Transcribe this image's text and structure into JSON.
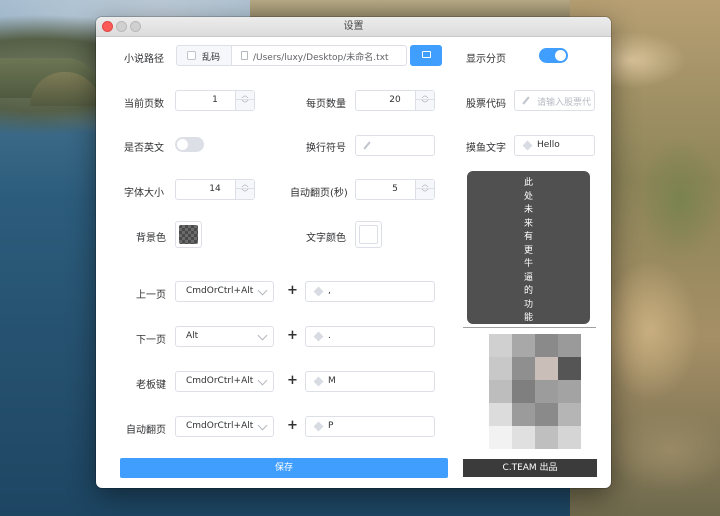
{
  "window": {
    "title": "设置"
  },
  "labels": {
    "novel_path": "小说路径",
    "show_paging": "显示分页",
    "current_page": "当前页数",
    "per_page": "每页数量",
    "stock_code": "股票代码",
    "is_english": "是否英文",
    "line_break": "换行符号",
    "fish_text": "摸鱼文字",
    "font_size": "字体大小",
    "auto_page_sec": "自动翻页(秒)",
    "bg_color": "背景色",
    "text_color": "文字颜色",
    "prev_page": "上一页",
    "next_page": "下一页",
    "boss_key": "老板键",
    "auto_page": "自动翻页"
  },
  "path_field": {
    "garbled_label": "乱码",
    "garbled_checked": false,
    "path_value": "/Users/luxy/Desktop/未命名.txt",
    "folder_icon": "folder-icon",
    "file_icon": "file-icon"
  },
  "toggles": {
    "show_paging": true,
    "is_english": false
  },
  "values": {
    "current_page": "1",
    "per_page": "20",
    "font_size": "14",
    "auto_page_sec": "5",
    "stock_placeholder": "请输入股票代",
    "line_break_value": "",
    "fish_text": "Hello"
  },
  "colors": {
    "accent": "#409eff",
    "background": "checkerboard-dark",
    "text": "#ffffff",
    "panel": "#505050"
  },
  "shortcuts": [
    {
      "modifier": "CmdOrCtrl+Alt",
      "plus": "+",
      "key": ","
    },
    {
      "modifier": "Alt",
      "plus": "+",
      "key": "."
    },
    {
      "modifier": "CmdOrCtrl+Alt",
      "plus": "+",
      "key": "M"
    },
    {
      "modifier": "CmdOrCtrl+Alt",
      "plus": "+",
      "key": "P"
    }
  ],
  "panel": {
    "chars": [
      "此",
      "处",
      "未",
      "来",
      "有",
      "更",
      "牛",
      "逼",
      "的",
      "功",
      "能"
    ]
  },
  "stepper": {
    "up": "︿",
    "down": "﹀"
  },
  "footer": {
    "save_label": "保存",
    "credit": "C.TEAM 出品"
  }
}
